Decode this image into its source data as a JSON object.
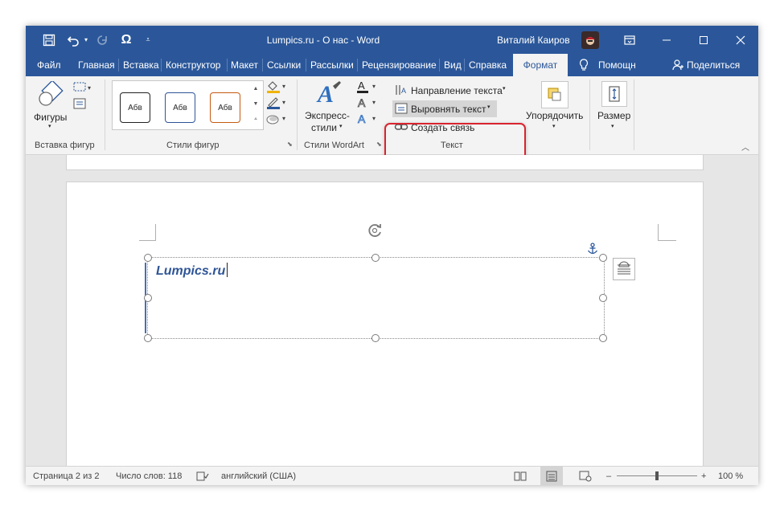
{
  "title": {
    "doc_title": "Lumpics.ru - О нас - Word",
    "user_name": "Виталий Каиров",
    "quick_access": [
      "save-icon",
      "undo-icon",
      "redo-icon",
      "symbol-omega-icon",
      "customize-qat-icon"
    ],
    "window_controls": [
      "ribbon-display-icon",
      "minimize-icon",
      "maximize-icon",
      "close-icon"
    ]
  },
  "tabs": [
    {
      "label": "Файл"
    },
    {
      "label": "Главная"
    },
    {
      "label": "Вставка"
    },
    {
      "label": "Конструктор"
    },
    {
      "label": "Макет"
    },
    {
      "label": "Ссылки"
    },
    {
      "label": "Рассылки"
    },
    {
      "label": "Рецензирование"
    },
    {
      "label": "Вид"
    },
    {
      "label": "Справка"
    },
    {
      "label": "Формат",
      "active": true
    }
  ],
  "help": {
    "label": "Помощн"
  },
  "share": {
    "label": "Поделиться"
  },
  "ribbon": {
    "insert_shapes": {
      "shapes_label": "Фигуры",
      "group_label": "Вставка фигур"
    },
    "shape_styles": {
      "samples": [
        "Абв",
        "Абв",
        "Абв"
      ],
      "sample_colors": [
        "#222222",
        "#2f5597",
        "#c55a11"
      ],
      "group_label": "Стили фигур"
    },
    "wordart": {
      "quick_styles_line1": "Экспресс-",
      "quick_styles_line2": "стили",
      "group_label": "Стили WordArt"
    },
    "text": {
      "direction": "Направление текста",
      "align": "Выровнять текст",
      "link": "Создать связь",
      "group_label": "Текст"
    },
    "arrange": {
      "label": "Упорядочить"
    },
    "size": {
      "label": "Размер"
    }
  },
  "document": {
    "textbox_text": "Lumpics.ru"
  },
  "status": {
    "page": "Страница 2 из 2",
    "words": "Число слов: 118",
    "language": "английский (США)",
    "zoom_minus": "–",
    "zoom_plus": "+",
    "zoom": "100 %"
  },
  "colors": {
    "accent": "#2b579a",
    "highlight": "#d9242f",
    "textbox_text": "#2f5597"
  }
}
